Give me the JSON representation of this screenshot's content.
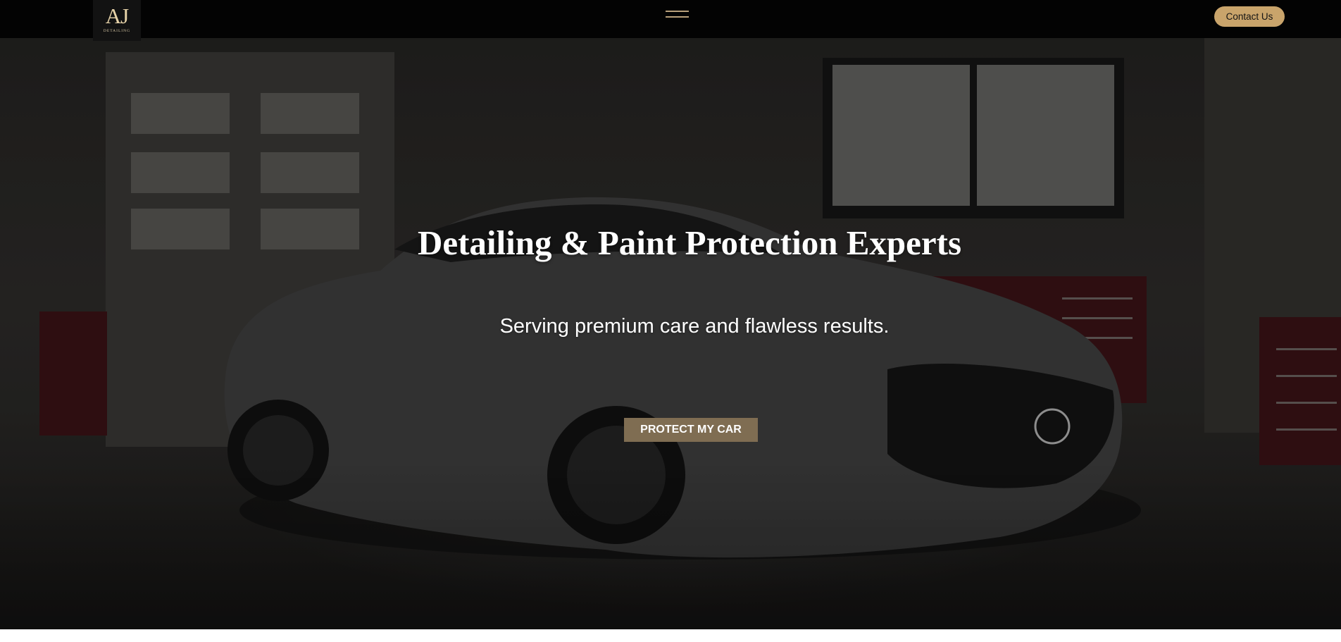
{
  "header": {
    "logo_mark": "AJ",
    "logo_sub": "DETAILING",
    "menu_icon": "hamburger-icon",
    "contact_label": "Contact Us"
  },
  "hero": {
    "title": "Detailing & Paint Protection Experts",
    "subtitle": "Serving premium care and flawless results.",
    "cta_label": "PROTECT MY CAR",
    "background_image": "dark-grey-sports-car-in-garage"
  },
  "colors": {
    "header_bg": "#030303",
    "accent_gold": "#c9a46b",
    "cta_bg": "#7f6d52",
    "hero_text": "#ffffff"
  }
}
